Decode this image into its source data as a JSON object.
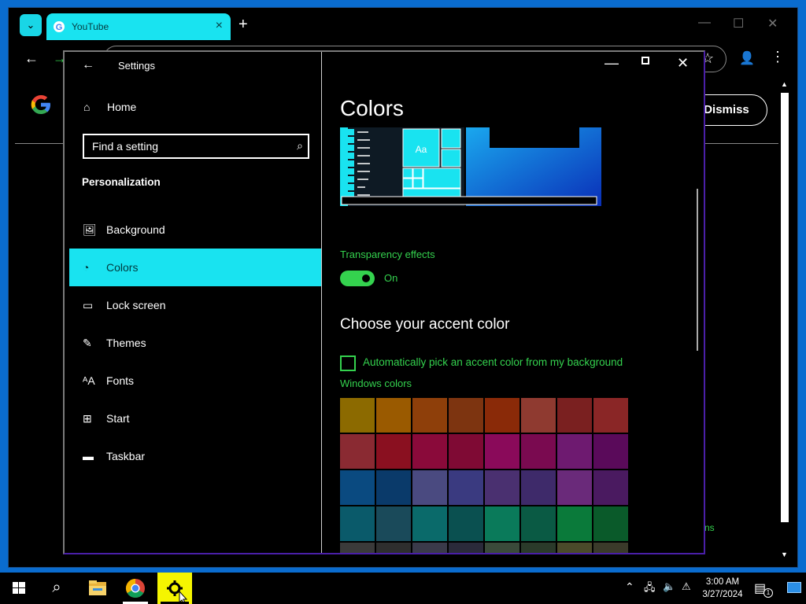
{
  "browser": {
    "tab_title": "YouTube",
    "new_tab_glyph": "+",
    "dismiss_label": "Dismiss",
    "fragment_text": "ns",
    "window_controls": {
      "minimize": "—",
      "maximize": "☐",
      "close": "✕"
    },
    "icons": [
      "tab-search-icon",
      "google-favicon",
      "close-icon",
      "back-arrow-icon",
      "forward-arrow-icon",
      "star-icon",
      "profile-icon",
      "kebab-menu-icon",
      "google-logo"
    ]
  },
  "settings": {
    "window_title": "Settings",
    "home_label": "Home",
    "search_placeholder": "Find a setting",
    "section_heading": "Personalization",
    "nav_items": [
      {
        "label": "Background",
        "icon": "image-icon",
        "glyph": "🖼"
      },
      {
        "label": "Colors",
        "icon": "palette-icon",
        "glyph": "◔",
        "selected": true
      },
      {
        "label": "Lock screen",
        "icon": "lock-screen-icon",
        "glyph": "▭"
      },
      {
        "label": "Themes",
        "icon": "themes-icon",
        "glyph": "✎"
      },
      {
        "label": "Fonts",
        "icon": "fonts-icon",
        "glyph": "ᴬA"
      },
      {
        "label": "Start",
        "icon": "start-icon",
        "glyph": "⊞"
      },
      {
        "label": "Taskbar",
        "icon": "taskbar-icon",
        "glyph": "▬"
      }
    ],
    "page_title": "Colors",
    "preview_sample_text": "Aa",
    "transparency_label": "Transparency effects",
    "transparency_state": "On",
    "transparency_on": true,
    "accent_heading": "Choose your accent color",
    "auto_accent_label": "Automatically pick an accent color from my background",
    "auto_accent_checked": false,
    "windows_colors_label": "Windows colors",
    "swatch_colors": [
      "#8c6a00",
      "#9a5a00",
      "#8e3f0a",
      "#7d3410",
      "#8a2a08",
      "#8f3a30",
      "#7a2020",
      "#8a2626",
      "#8a2a32",
      "#8a1020",
      "#8a0a3a",
      "#7f0a34",
      "#8a0a5a",
      "#7a0a50",
      "#6e1a70",
      "#5a0a5a",
      "#0a4a80",
      "#0a3a6a",
      "#4a4a80",
      "#3a3a80",
      "#4a3070",
      "#3e2a6a",
      "#6a2a7a",
      "#4a1a60",
      "#0a5a6a",
      "#1a4a5a",
      "#0a6a6a",
      "#0a5050",
      "#0a7a5a",
      "#0a5a44",
      "#0a7a3a",
      "#0a5a2a",
      "#3a3a3a",
      "#2e2e2e",
      "#3a3a4a",
      "#2a2a3a",
      "#3a4a3a",
      "#2a3a2a",
      "#4a4a2a",
      "#3a3a2a"
    ],
    "accent_color": "#19e3f0",
    "highlight_green": "#34d24e"
  },
  "taskbar": {
    "clock_time": "3:00 AM",
    "clock_date": "3/27/2024",
    "notification_count": "1",
    "apps": [
      "windows-start-icon",
      "search-icon",
      "file-explorer-icon",
      "chrome-icon",
      "settings-gear-icon"
    ]
  }
}
